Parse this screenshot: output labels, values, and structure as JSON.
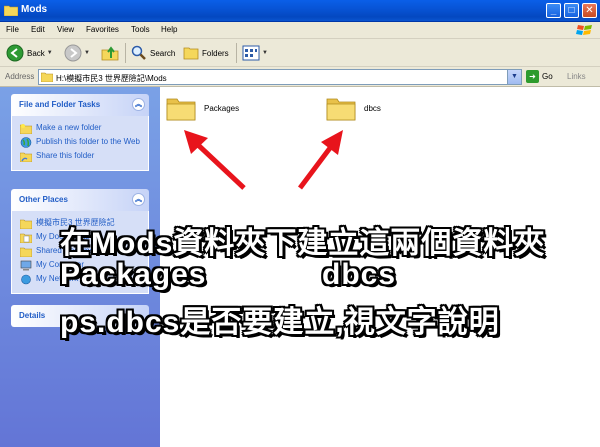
{
  "window": {
    "title": "Mods"
  },
  "menu": [
    "File",
    "Edit",
    "View",
    "Favorites",
    "Tools",
    "Help"
  ],
  "toolbar": {
    "back": "Back",
    "search": "Search",
    "folders": "Folders"
  },
  "address": {
    "label": "Address",
    "path": "H:\\模擬市民3 世界歷險記\\Mods",
    "go": "Go",
    "links": "Links"
  },
  "tasks": {
    "title": "File and Folder Tasks",
    "items": [
      "Make a new folder",
      "Publish this folder to the Web",
      "Share this folder"
    ]
  },
  "other_places": {
    "title": "Other Places",
    "items": [
      "模擬市民3 世界歷險記",
      "My Documents",
      "Shared Documents",
      "My Computer",
      "My Network Places"
    ]
  },
  "details": {
    "title": "Details"
  },
  "folders": [
    "Packages",
    "dbcs"
  ],
  "annotation": {
    "line1": "在Mods資料夾下建立這兩個資料夾",
    "line2_left": "Packages",
    "line2_right": "dbcs",
    "line3": "ps.dbcs是否要建立,視文字說明"
  },
  "colors": {
    "titlebar": "#0854d6",
    "taskpane": "#6f8ee0",
    "link": "#215dc6",
    "arrow": "#e8141c",
    "overlay_text": "#ffffff"
  }
}
